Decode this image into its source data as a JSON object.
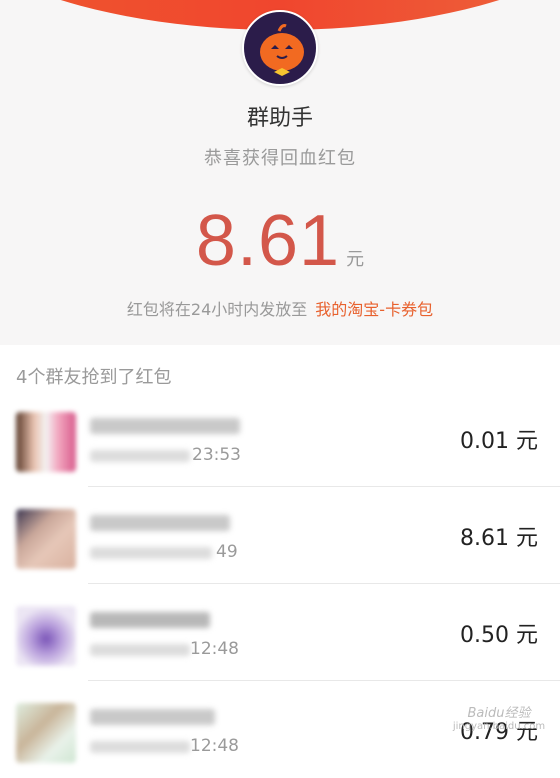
{
  "header": {
    "title": "群助手",
    "subtitle": "恭喜获得回血红包",
    "amount": "8.61",
    "amount_unit": "元",
    "note_prefix": "红包将在24小时内发放至",
    "note_link": "我的淘宝-卡券包",
    "avatar_icon": "pumpkin-mascot-icon",
    "colors": {
      "accent_red": "#d3574a",
      "link_orange": "#e8612e",
      "banner_red": "#ee5a2e"
    }
  },
  "list": {
    "count_text": "4个群友抢到了红包",
    "rows": [
      {
        "time": "23:53",
        "amount": "0.01 元"
      },
      {
        "time": "49",
        "amount": "8.61 元"
      },
      {
        "time": "12:48",
        "amount": "0.50 元"
      },
      {
        "time": "12:48",
        "amount": "0.79 元"
      }
    ]
  },
  "watermark": {
    "text": "Baidu经验",
    "url": "jingyan.baidu.com"
  }
}
